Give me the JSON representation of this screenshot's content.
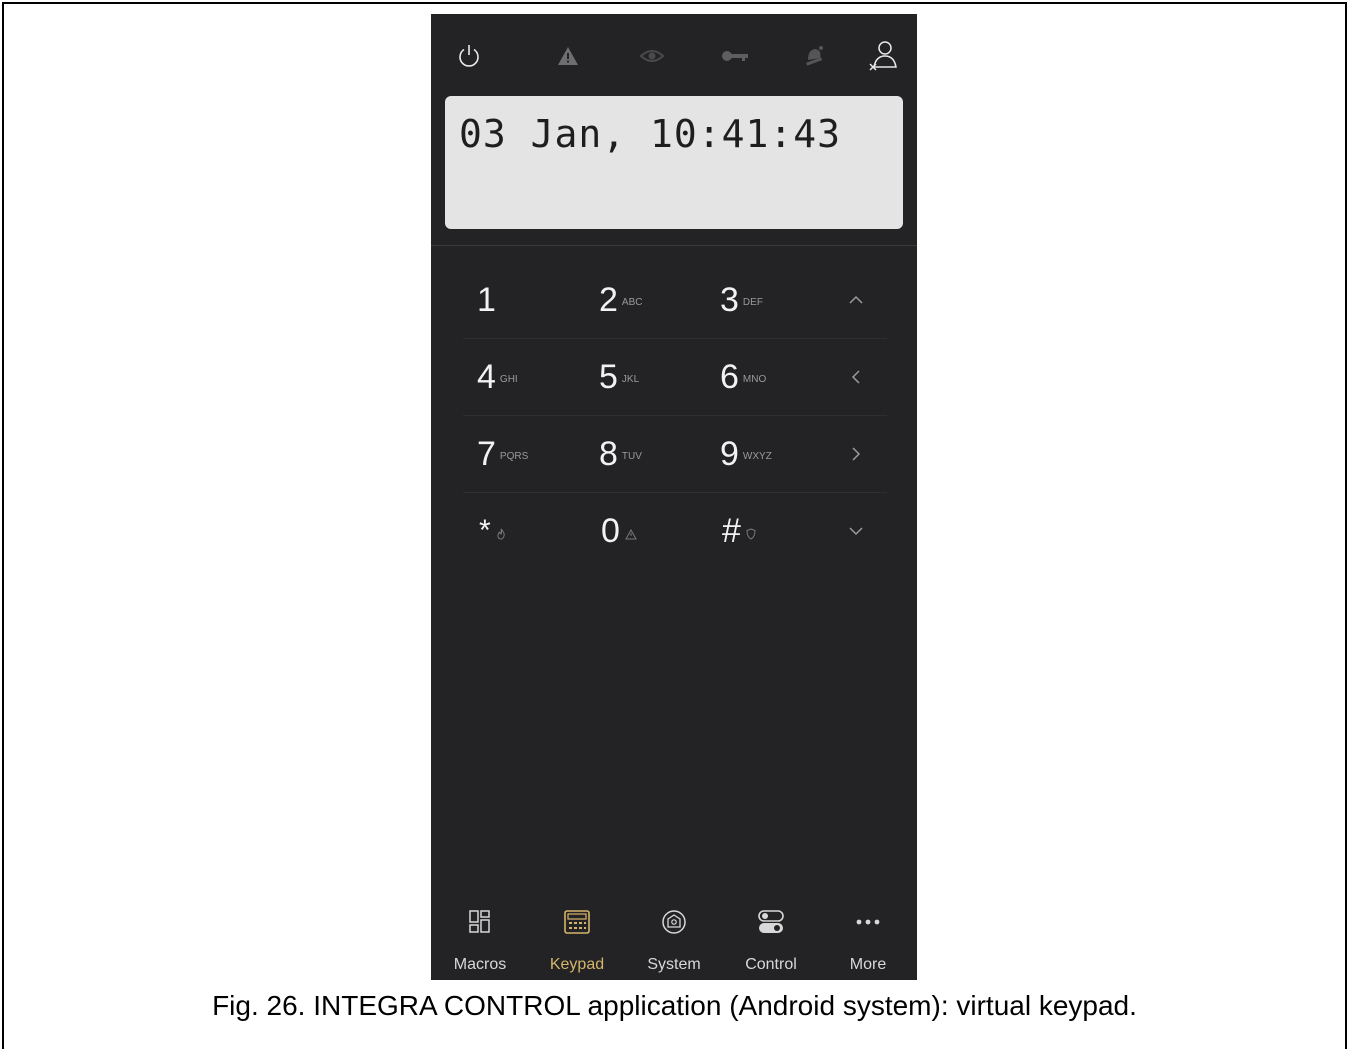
{
  "status_icons": [
    "power-icon",
    "alarm-warning-icon",
    "eye-icon",
    "key-icon",
    "fire-bell-icon",
    "user-logout-icon"
  ],
  "display": {
    "text": "03 Jan, 10:41:43"
  },
  "keypad": {
    "rows": [
      {
        "keys": [
          {
            "digit": "1",
            "letters": ""
          },
          {
            "digit": "2",
            "letters": "ABC"
          },
          {
            "digit": "3",
            "letters": "DEF"
          }
        ],
        "arrow": "chevron-up-icon"
      },
      {
        "keys": [
          {
            "digit": "4",
            "letters": "GHI"
          },
          {
            "digit": "5",
            "letters": "JKL"
          },
          {
            "digit": "6",
            "letters": "MNO"
          }
        ],
        "arrow": "chevron-left-icon"
      },
      {
        "keys": [
          {
            "digit": "7",
            "letters": "PQRS"
          },
          {
            "digit": "8",
            "letters": "TUV"
          },
          {
            "digit": "9",
            "letters": "WXYZ"
          }
        ],
        "arrow": "chevron-right-icon"
      },
      {
        "keys": [
          {
            "digit": "*",
            "icon": "fire-icon"
          },
          {
            "digit": "0",
            "icon": "warning-icon"
          },
          {
            "digit": "#",
            "icon": "shield-icon"
          }
        ],
        "arrow": "chevron-down-icon"
      }
    ]
  },
  "nav": {
    "items": [
      {
        "label": "Macros",
        "icon": "macros-icon",
        "active": false
      },
      {
        "label": "Keypad",
        "icon": "keypad-icon",
        "active": true
      },
      {
        "label": "System",
        "icon": "system-icon",
        "active": false
      },
      {
        "label": "Control",
        "icon": "control-toggle-icon",
        "active": false
      },
      {
        "label": "More",
        "icon": "more-dots-icon",
        "active": false
      }
    ]
  },
  "colors": {
    "background": "#232325",
    "accent": "#d4b56a",
    "display": "#e4e4e4"
  },
  "caption": "Fig. 26. INTEGRA CONTROL application (Android system): virtual keypad."
}
